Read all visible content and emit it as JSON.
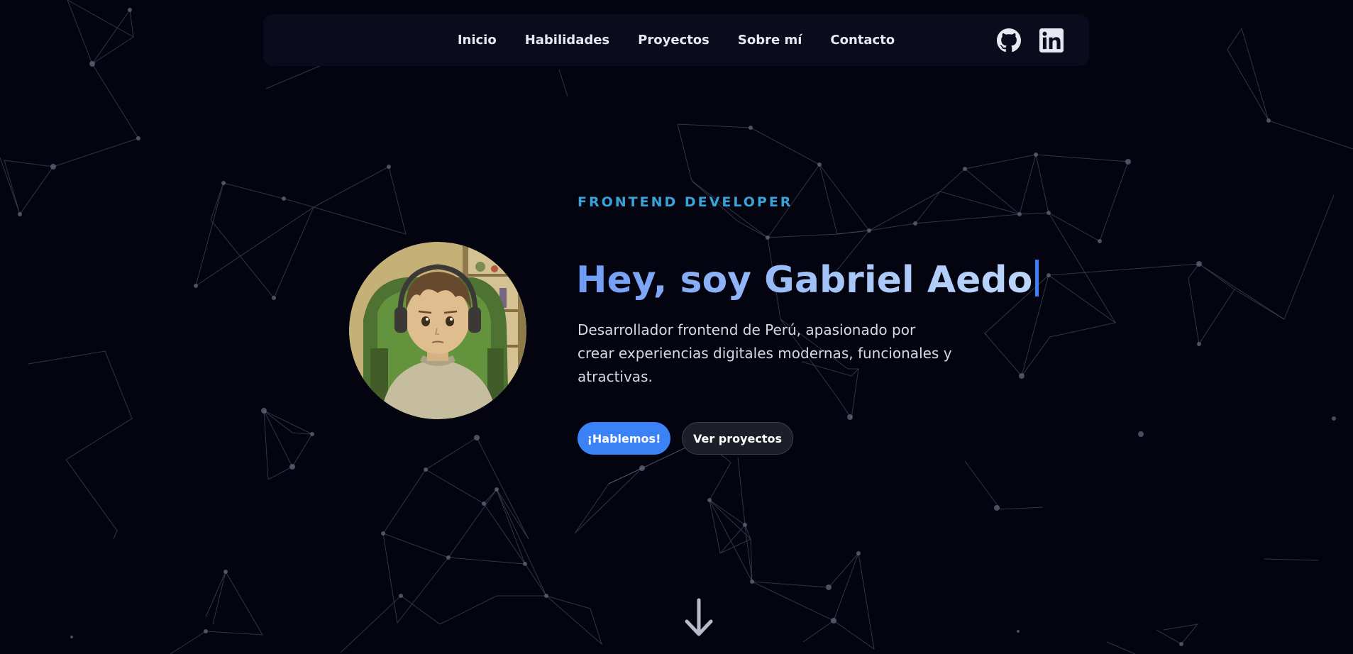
{
  "nav": {
    "links": [
      "Inicio",
      "Habilidades",
      "Proyectos",
      "Sobre mí",
      "Contacto"
    ],
    "social_icons": [
      "github-icon",
      "linkedin-icon"
    ]
  },
  "hero": {
    "eyebrow": "FRONTEND DEVELOPER",
    "title": "Hey, soy Gabriel Aedo",
    "description": "Desarrollador frontend de Perú, apasionado por crear experiencias digitales modernas, funcionales y atractivas.",
    "primary_button": "¡Hablemos!",
    "secondary_button": "Ver proyectos"
  },
  "colors": {
    "background": "#03040f",
    "navbar": "#0a0c1d",
    "accent": "#3b82f6",
    "eyebrow": "#38a3d8",
    "title_gradient_start": "#6f9bf5",
    "title_gradient_end": "#bcd5fa"
  },
  "icons": {
    "scroll": "arrow-down-icon"
  }
}
